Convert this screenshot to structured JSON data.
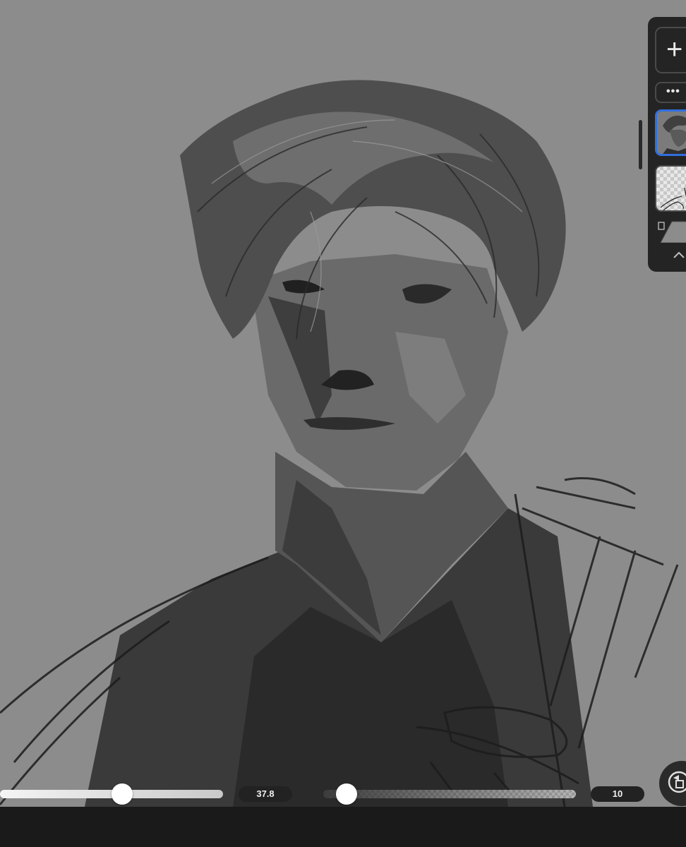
{
  "app": {
    "canvas_background": "#8c8c8c",
    "accent_color": "#2f6fe0"
  },
  "layers_panel": {
    "add_layer_label": "+",
    "more_label": "•••",
    "layers": [
      {
        "name_icon": "portrait-layer-thumbnail",
        "selected": true
      },
      {
        "name_icon": "sketch-layer-thumbnail",
        "selected": false
      }
    ]
  },
  "brush_controls": {
    "size_value": "37.8",
    "opacity_value": "10",
    "size_level": 0.55,
    "opacity_level": 0.09
  },
  "icons": {
    "add": "plus-icon",
    "more": "ellipsis-icon",
    "paper": "paper-icon",
    "collapse": "chevron-up-icon",
    "rotate": "rotate-icon"
  }
}
